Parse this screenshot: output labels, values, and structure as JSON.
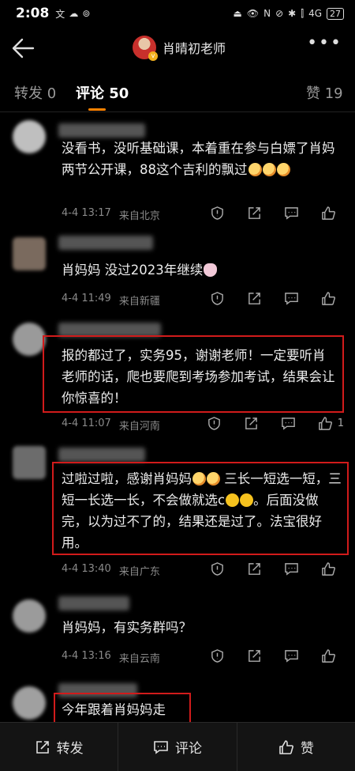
{
  "status": {
    "time": "2:08",
    "left_icons": [
      "文",
      "☁",
      "⊚"
    ],
    "right_icons": [
      "⏏",
      "👁",
      "N",
      "⊘",
      "✱",
      "⫿"
    ],
    "network": "4G",
    "battery": "27"
  },
  "header": {
    "author_name": "肖晴初老师"
  },
  "tabs": {
    "repost": "转发 0",
    "comments": "评论 50",
    "likes": "赞 19"
  },
  "comments": [
    {
      "text": "没看书，没听基础课，本着重在参与白嫖了肖妈两节公开课，88这个吉利的飘过",
      "date": "4-4 13:17",
      "location": "来自北京",
      "like_count": ""
    },
    {
      "text": "肖妈妈 没过2023年继续",
      "date": "4-4 11:49",
      "location": "来自新疆",
      "like_count": ""
    },
    {
      "text": "报的都过了，实务95，谢谢老师！一定要听肖老师的话，爬也要爬到考场参加考试，结果会让你惊喜的！",
      "date": "4-4 11:07",
      "location": "来自河南",
      "like_count": "1"
    },
    {
      "text_part1": "过啦过啦，感谢肖妈妈",
      "text_part2": " 三长一短选一短，三短一长选一长，不会做就选c",
      "text_part3": "。后面没做完，以为过不了的，结果还是过了。法宝很好用。",
      "date": "4-4 13:40",
      "location": "来自广东",
      "like_count": ""
    },
    {
      "text": "肖妈妈，有实务群吗？",
      "date": "4-4 13:16",
      "location": "来自云南",
      "like_count": ""
    },
    {
      "text": "今年跟着肖妈妈走"
    }
  ],
  "bottom": {
    "repost": "转发",
    "comment": "评论",
    "like": "赞"
  }
}
